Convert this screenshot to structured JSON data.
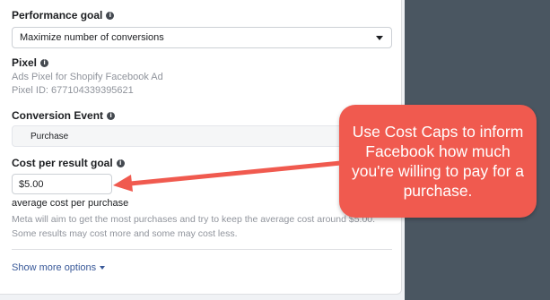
{
  "performance_goal": {
    "label": "Performance goal",
    "selected": "Maximize number of conversions"
  },
  "pixel": {
    "label": "Pixel",
    "name": "Ads Pixel for Shopify Facebook Ad",
    "id_text": "Pixel ID: 677104339395621"
  },
  "conversion_event": {
    "label": "Conversion Event",
    "value": "Purchase"
  },
  "cost_goal": {
    "label": "Cost per result goal",
    "value": "$5.00",
    "help": "average cost per purchase",
    "description": "Meta will aim to get the most purchases and try to keep the average cost around $5.00. Some results may cost more and some may cost less."
  },
  "show_more": "Show more options",
  "callout": {
    "text": "Use Cost Caps to inform Facebook how much you're willing to pay for a purchase.",
    "color": "#f05a4f"
  },
  "icons": {
    "info": "info-icon",
    "caret": "chevron-down-icon"
  }
}
